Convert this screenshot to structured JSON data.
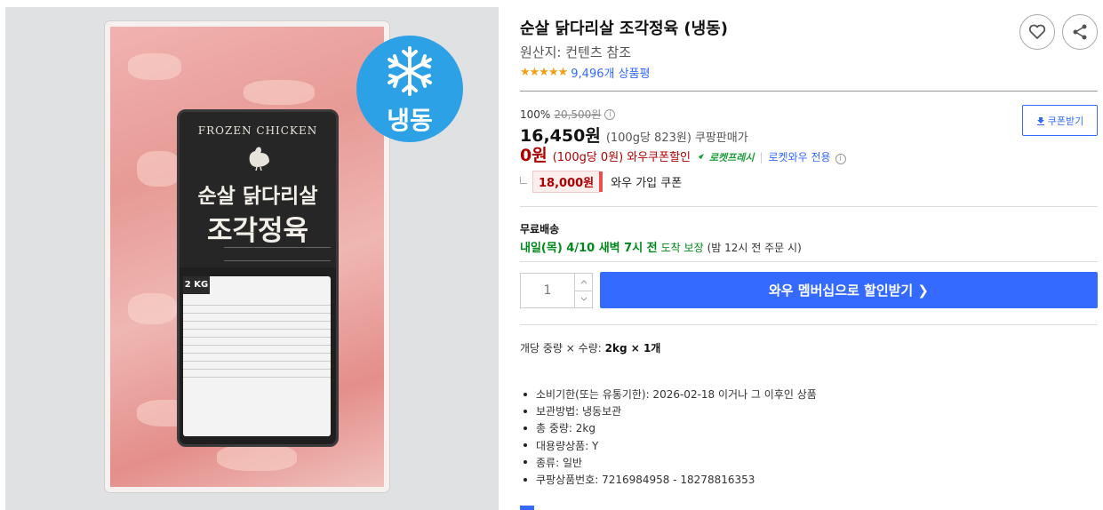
{
  "image": {
    "badge_text": "냉동",
    "label_brand": "FROZEN CHICKEN",
    "label_title_1": "순살 닭다리살",
    "label_title_2": "조각정육",
    "label_weight": "2 KG"
  },
  "product": {
    "title": "순살 닭다리살 조각정육 (냉동)",
    "origin": "원산지: 컨텐츠 참조",
    "rating_stars": "★★★★★",
    "review_count": "9,496개 상품평"
  },
  "actions": {
    "wishlist_icon": "heart-icon",
    "share_icon": "share-icon"
  },
  "pricing": {
    "discount_rate": "100%",
    "original_price": "20,500원",
    "sale_price": "16,450원",
    "unit_price": "(100g당 823원)",
    "seller_type": "쿠팡판매가",
    "wow_price": "0원",
    "wow_unit_price": "(100g당 0원)",
    "wow_label": "와우쿠폰할인",
    "rocket_label": "로켓프레시",
    "rocket_wow_only": "로켓와우 전용",
    "coupon_button": "쿠폰받기",
    "join_coupon_price": "18,000원",
    "join_coupon_label": "와우 가입 쿠폰"
  },
  "shipping": {
    "title": "무료배송",
    "arrival": "내일(목) 4/10 새벽 7시 전",
    "guarantee": "도착 보장",
    "cutoff_note": "(밤 12시 전 주문 시)"
  },
  "purchase": {
    "quantity": "1",
    "wow_button": "와우 멤버십으로 할인받기 ❯"
  },
  "details": {
    "pack_info_prefix": "개당 중량 × 수량: ",
    "pack_info_value": "2kg × 1개",
    "specs": [
      "소비기한(또는 유통기한): 2026-02-18 이거나 그 이후인 상품",
      "보관방법: 냉동보관",
      "총 중량: 2kg",
      "대용량상품: Y",
      "종류: 일반",
      "쿠팡상품번호: 7216984958 - 18278816353"
    ]
  },
  "colors": {
    "accent_blue": "#346aff",
    "price_red": "#ae0000",
    "delivery_green": "#00891a",
    "badge_blue": "#2da1e6",
    "star_orange": "#f3a018"
  }
}
